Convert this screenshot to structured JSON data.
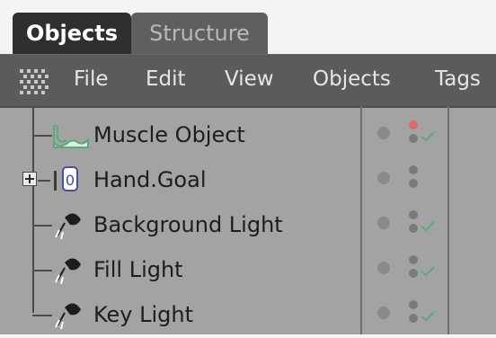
{
  "tabs": [
    {
      "label": "Objects"
    },
    {
      "label": "Structure"
    }
  ],
  "menu": {
    "items": [
      "File",
      "Edit",
      "View",
      "Objects",
      "Tags"
    ]
  },
  "objects": [
    {
      "name": "Muscle Object",
      "icon": "muscle-object-icon"
    },
    {
      "name": "Hand.Goal",
      "icon": "null-object-icon"
    },
    {
      "name": "Background Light",
      "icon": "light-icon"
    },
    {
      "name": "Fill Light",
      "icon": "light-icon"
    },
    {
      "name": "Key Light",
      "icon": "light-icon"
    }
  ],
  "colors": {
    "active_tab": "#2f2f2f",
    "menubar": "#5b5b5b",
    "tree_bg": "#a3a3a3",
    "render_dot_active": "#e06a6a",
    "check": "#5ea97b",
    "muscle_icon": "#6dbb8a"
  }
}
